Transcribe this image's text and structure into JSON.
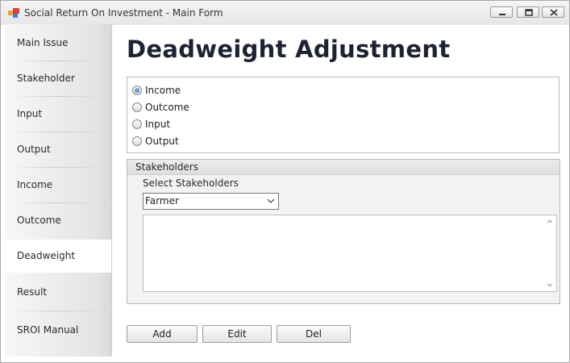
{
  "window": {
    "title": "Social Return On Investment - Main Form"
  },
  "sidebar": {
    "items": [
      {
        "label": "Main Issue"
      },
      {
        "label": "Stakeholder"
      },
      {
        "label": "Input"
      },
      {
        "label": "Output"
      },
      {
        "label": "Income"
      },
      {
        "label": "Outcome"
      },
      {
        "label": "Deadweight"
      },
      {
        "label": "Result"
      },
      {
        "label": "SROI Manual"
      }
    ],
    "active": "Deadweight"
  },
  "main": {
    "title": "Deadweight Adjustment",
    "radio_options": [
      {
        "label": "Income",
        "checked": true
      },
      {
        "label": "Outcome",
        "checked": false
      },
      {
        "label": "Input",
        "checked": false
      },
      {
        "label": "Output",
        "checked": false
      }
    ],
    "stakeholders_group": {
      "caption": "Stakeholders",
      "select_label": "Select Stakeholders",
      "selected_value": "Farmer",
      "memo_text": ""
    },
    "buttons": {
      "add": "Add",
      "edit": "Edit",
      "del": "Del"
    }
  },
  "colors": {
    "title_text": "#1f2233",
    "radio_checked": "#2f6db5",
    "sidebar_active": "#ffffff"
  }
}
